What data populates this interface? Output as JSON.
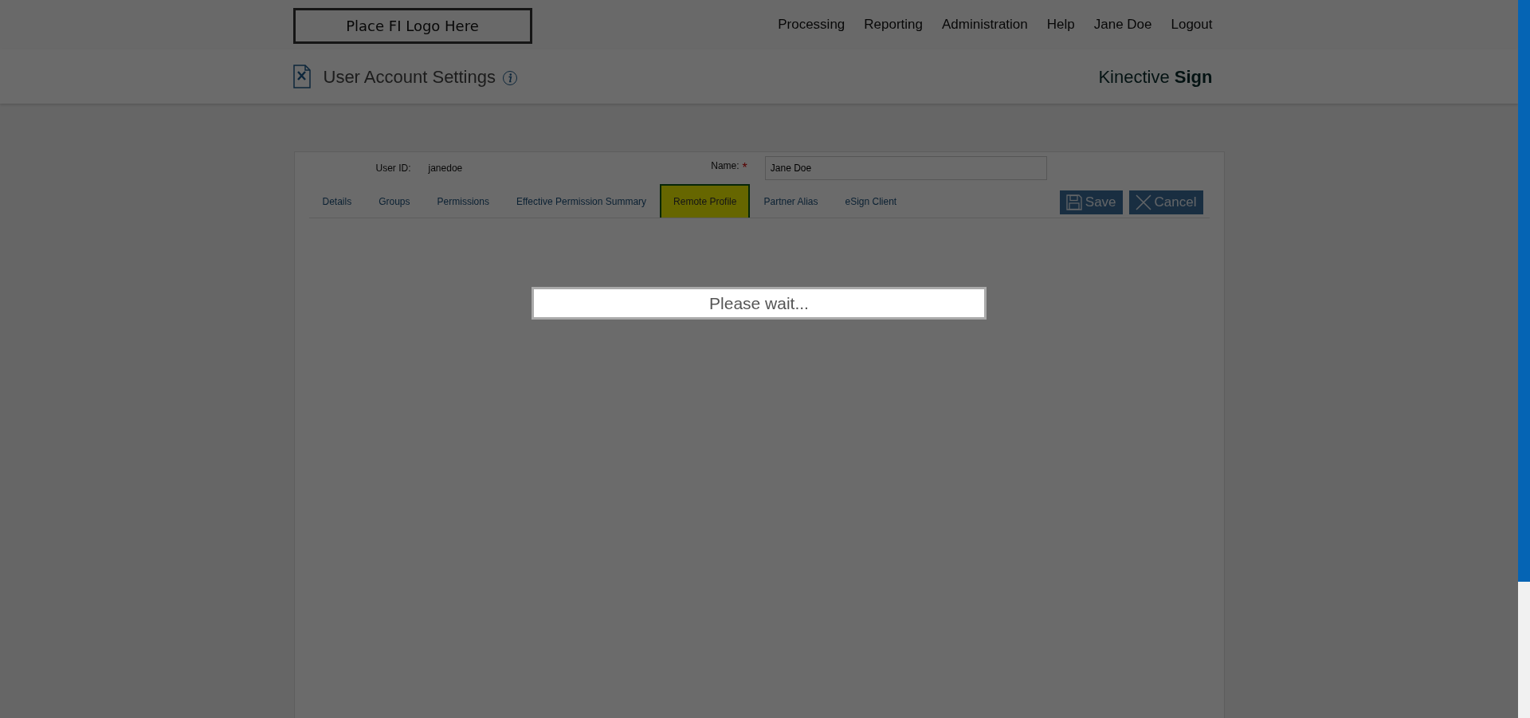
{
  "header": {
    "logo_placeholder": "Place FI Logo Here",
    "nav": [
      "Processing",
      "Reporting",
      "Administration",
      "Help",
      "Jane Doe",
      "Logout"
    ]
  },
  "subheader": {
    "title": "User Account Settings",
    "brand": "Kinective **Sign**"
  },
  "form": {
    "user_id_label": "User ID:",
    "user_id_value": "janedoe",
    "name_label": "Name:",
    "required_mark": "*",
    "name_value": "Jane Doe"
  },
  "tabs": [
    {
      "label": "Details",
      "selected": false
    },
    {
      "label": "Groups",
      "selected": false
    },
    {
      "label": "Permissions",
      "selected": false
    },
    {
      "label": "Effective Permission Summary",
      "selected": false
    },
    {
      "label": "Remote Profile",
      "selected": true
    },
    {
      "label": "Partner Alias",
      "selected": false
    },
    {
      "label": "eSign Client",
      "selected": false
    }
  ],
  "buttons": [
    {
      "kind": "save",
      "label": "Save"
    },
    {
      "kind": "cancel",
      "label": "Cancel"
    }
  ],
  "loading": {
    "message": "Please wait..."
  }
}
